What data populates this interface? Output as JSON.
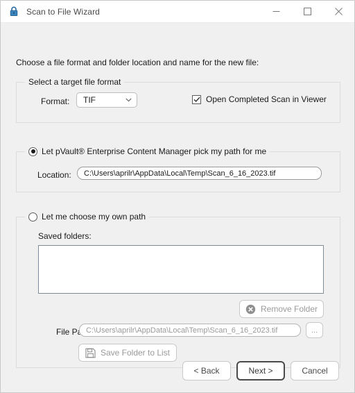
{
  "window": {
    "title": "Scan to File Wizard",
    "icon": "padlock-icon",
    "minimize_label": "—",
    "maximize_label": "□",
    "close_label": "✕"
  },
  "intro": {
    "text": "Choose a file format and folder location and name for the new file:"
  },
  "format_group": {
    "legend": "Select a target file format",
    "format_label": "Format:",
    "format_value": "TIF",
    "format_options": [
      "TIF"
    ],
    "open_in_viewer_label": "Open Completed Scan in Viewer",
    "open_in_viewer_checked": true,
    "checkmark": "✓"
  },
  "auto_path_group": {
    "radio_label": "Let pVault® Enterprise Content Manager pick my path for me",
    "selected": true,
    "location_label": "Location:",
    "location_value": "C:\\Users\\aprilr\\AppData\\Local\\Temp\\Scan_6_16_2023.tif"
  },
  "manual_path_group": {
    "radio_label": "Let me choose my own path",
    "selected": false,
    "saved_folders_label": "Saved folders:",
    "saved_folders_items": [],
    "remove_folder_label": "Remove Folder",
    "remove_folder_icon": "remove-circle-icon",
    "remove_folder_disabled": true,
    "file_path_label": "File Path:",
    "file_path_value": "C:\\Users\\aprilr\\AppData\\Local\\Temp\\Scan_6_16_2023.tif",
    "file_path_disabled": true,
    "browse_label": "...",
    "save_folder_label": "Save Folder to List",
    "save_folder_icon": "floppy-disk-icon",
    "save_folder_disabled": true
  },
  "footer": {
    "back_label": "< Back",
    "next_label": "Next >",
    "cancel_label": "Cancel"
  },
  "colors": {
    "window_bg": "#f0f0f0",
    "titlebar_bg": "#ffffff",
    "accent": "#2b6ca3",
    "listbox_border": "#7e8b99"
  }
}
